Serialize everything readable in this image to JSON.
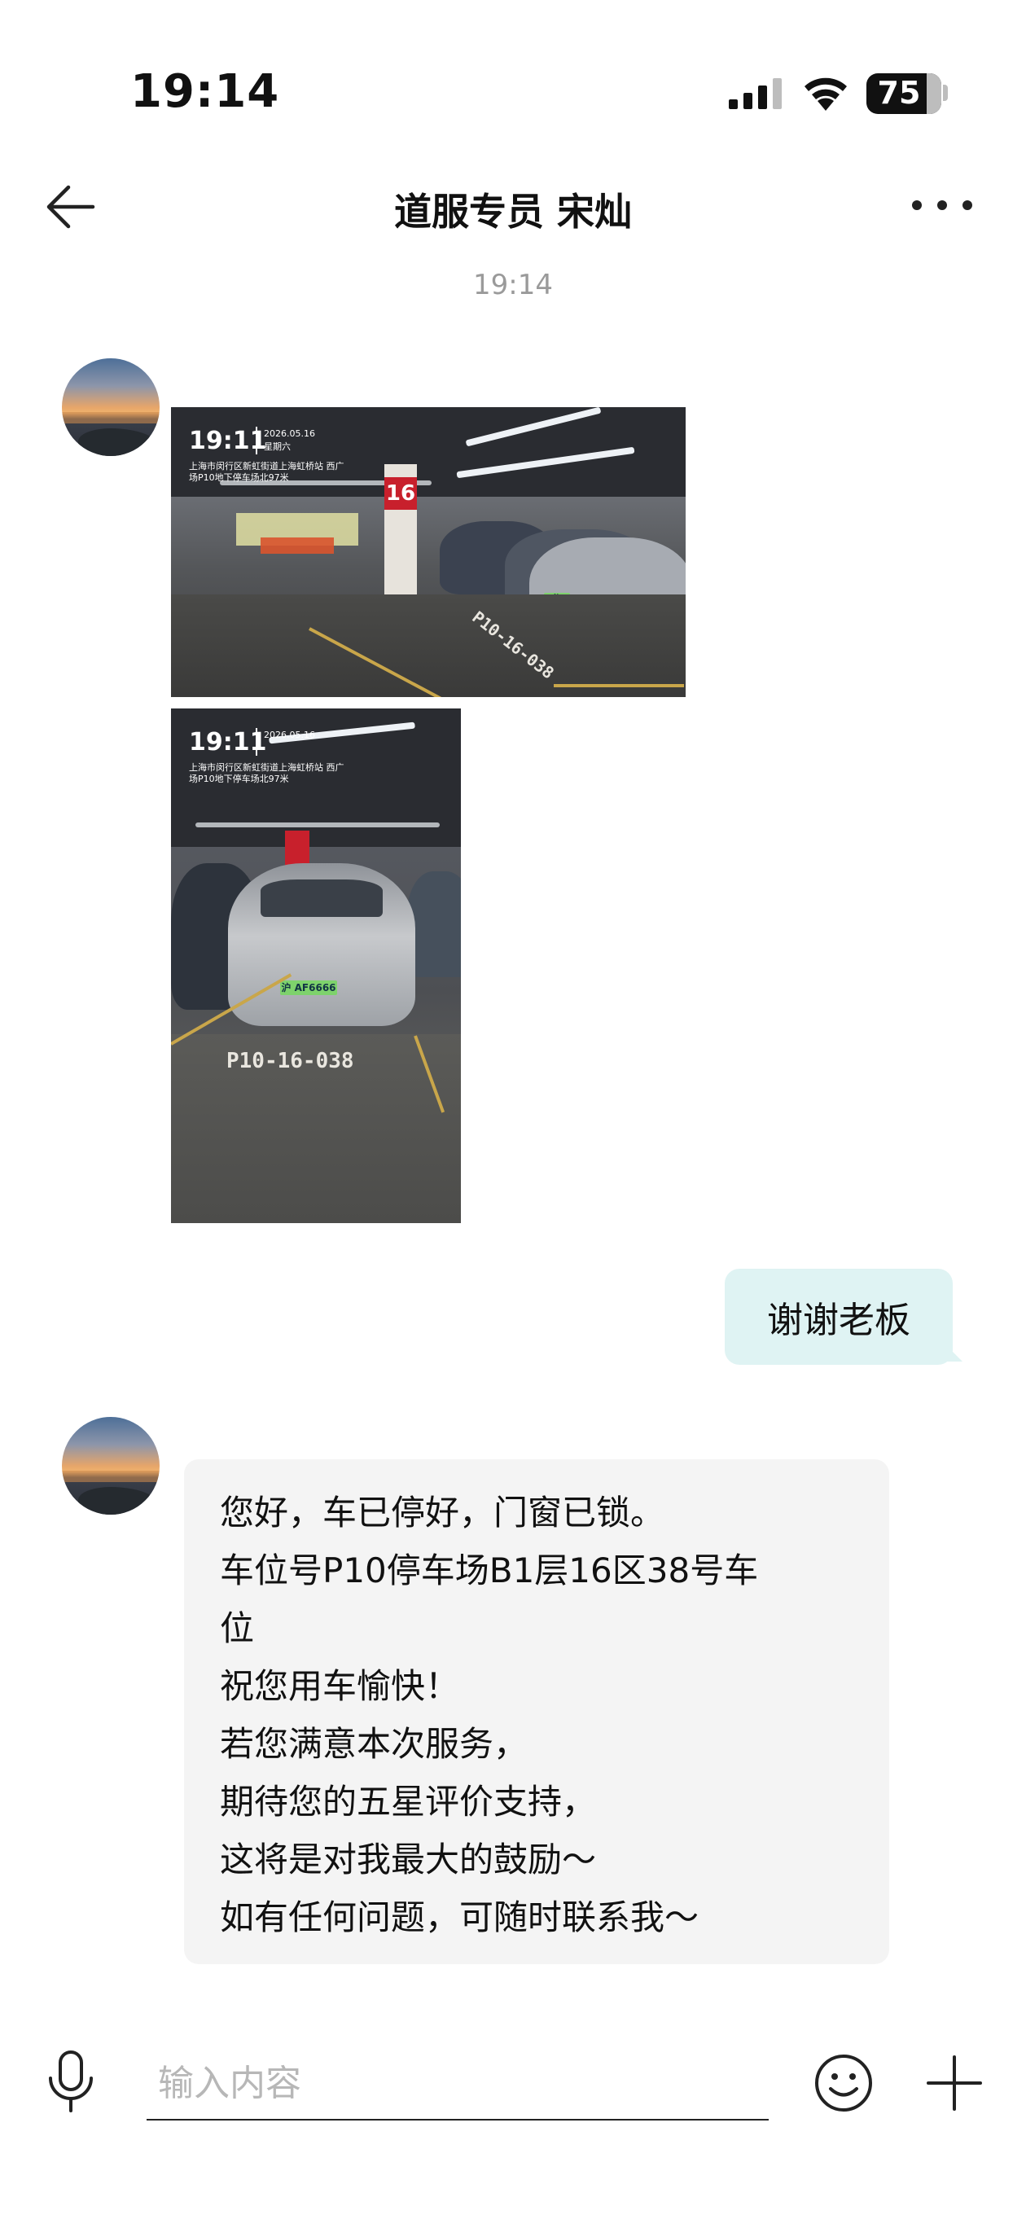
{
  "status_bar": {
    "time": "19:14",
    "battery": "75",
    "icons": [
      "signal-icon",
      "wifi-icon",
      "battery-icon"
    ]
  },
  "nav": {
    "title": "道服专员 宋灿",
    "back_icon": "back-arrow-icon",
    "more_icon": "more-icon"
  },
  "chat": {
    "timestamp": "19:14",
    "photos": [
      {
        "watermark_time": "19:11",
        "watermark_date": "2026.05.16",
        "watermark_weekday": "星期六",
        "watermark_address": "上海市闵行区新虹街道上海虹桥站 西广场P10地下停车场北97米",
        "pillar_sign": "16",
        "floor_marking": "P10-16-038"
      },
      {
        "watermark_time": "19:11",
        "watermark_date": "2026.05.16",
        "watermark_address": "上海市闵行区新虹街道上海虹桥站 西广场P10地下停车场北97米",
        "plate": "沪 AF6666",
        "floor_marking": "P10-16-038"
      }
    ],
    "reply": "谢谢老板",
    "message_lines": [
      "您好，车已停好，门窗已锁。",
      "车位号P10停车场B1层16区38号车",
      "位",
      "祝您用车愉快！",
      "若您满意本次服务，",
      "期待您的五星评价支持，",
      "这将是对我最大的鼓励～",
      "如有任何问题，可随时联系我～"
    ]
  },
  "input_bar": {
    "placeholder": "输入内容",
    "icons": [
      "microphone-icon",
      "emoji-icon",
      "plus-icon"
    ]
  },
  "colors": {
    "right_bubble": "#dff3f3",
    "left_bubble": "#f4f4f4",
    "timestamp": "#9a9a9a",
    "placeholder": "#b7b7b7"
  }
}
